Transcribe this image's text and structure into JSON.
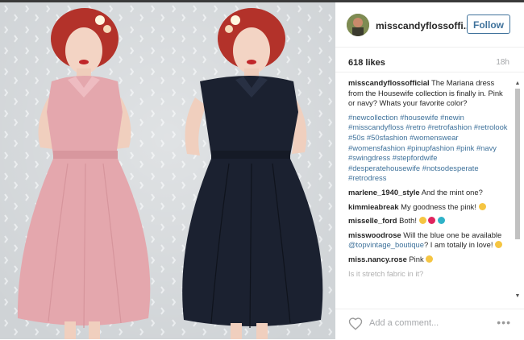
{
  "post": {
    "username": "misscandyflossoffi...",
    "follow_label": "Follow",
    "likes": "618 likes",
    "time": "18h",
    "add_comment_placeholder": "Add a comment...",
    "more_label": "•••"
  },
  "caption": {
    "user": "misscandyflossofficial",
    "text": "The Mariana dress from the Housewife collection is finally in. Pink or navy? Whats your favorite color?",
    "hashtags": "#newcollection #housewife #newin #misscandyfloss #retro #retrofashion #retrolook #50s #50sfashion #womenswear #womensfashion #pinupfashion #pink #navy #swingdress #stepfordwife #desperatehousewife #notsodesperate #retrodress"
  },
  "comments": [
    {
      "user": "marlene_1940_style",
      "text": "And the mint one?"
    },
    {
      "user": "kimmieabreak",
      "text": "My goodness the pink!"
    },
    {
      "user": "misselle_ford",
      "text": "Both!"
    },
    {
      "user": "misswoodrose",
      "text_before": "Will the blue one be available",
      "mention": "@topvintage_boutique",
      "text_after": "? I am totally in love!"
    },
    {
      "user": "miss.nancy.rose",
      "text": "Pink"
    },
    {
      "user": "",
      "text": "Is it stretch fabric in it?"
    }
  ],
  "colors": {
    "link": "#3f729b",
    "pink_dress": "#e4a7ad",
    "navy_dress": "#1b2130",
    "hair": "#c0392b"
  }
}
